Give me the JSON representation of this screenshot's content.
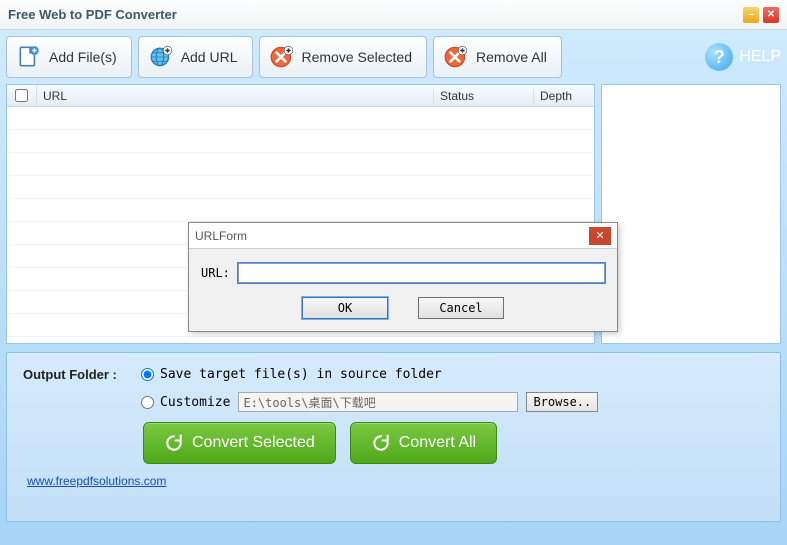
{
  "window": {
    "title": "Free Web to PDF Converter"
  },
  "toolbar": {
    "add_files": "Add File(s)",
    "add_url": "Add URL",
    "remove_selected": "Remove Selected",
    "remove_all": "Remove All",
    "help": "HELP"
  },
  "table": {
    "headers": {
      "url": "URL",
      "status": "Status",
      "depth": "Depth"
    }
  },
  "output": {
    "label": "Output Folder :",
    "radio_source": "Save target file(s) in source folder",
    "radio_custom": "Customize",
    "custom_path": "E:\\tools\\桌面\\下载吧",
    "browse": "Browse..",
    "convert_selected": "Convert Selected",
    "convert_all": "Convert All"
  },
  "footer": {
    "link": "www.freepdfsolutions.com"
  },
  "dialog": {
    "title": "URLForm",
    "url_label": "URL:",
    "ok": "OK",
    "cancel": "Cancel"
  }
}
